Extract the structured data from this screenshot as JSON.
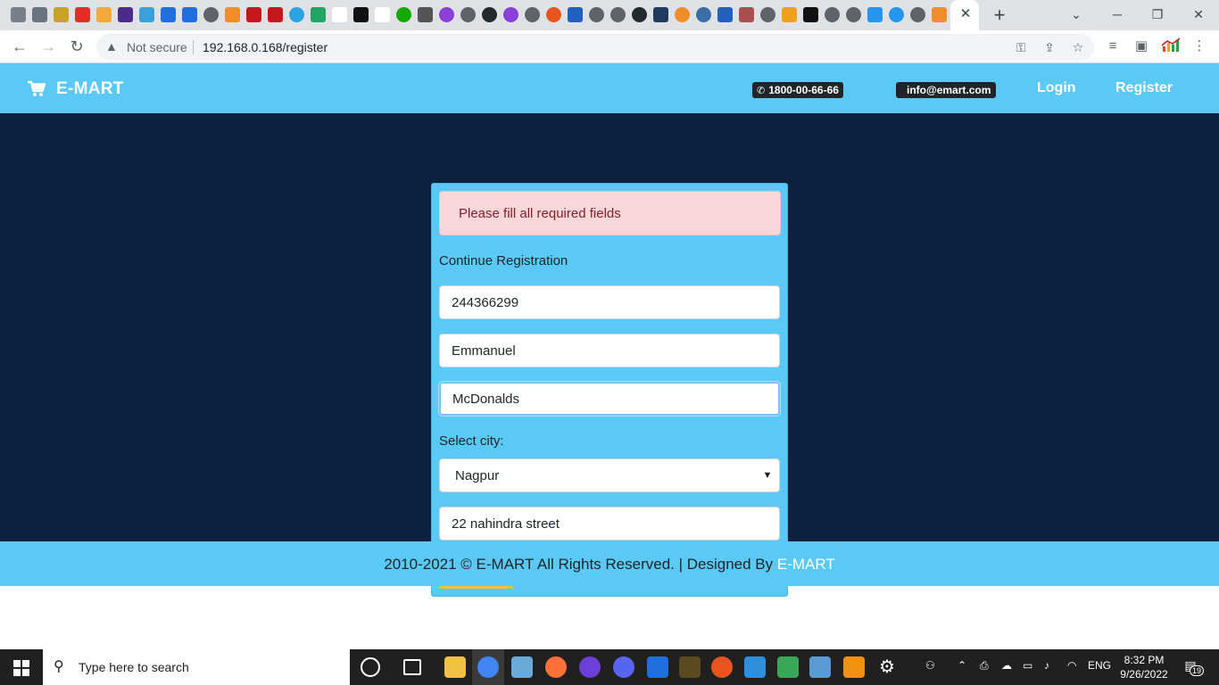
{
  "browser": {
    "address": {
      "security_label": "Not secure",
      "url": "192.168.0.168/register"
    }
  },
  "header": {
    "brand": "E-MART",
    "phone": "1800-00-66-66",
    "email": "info@emart.com",
    "nav": {
      "login": "Login",
      "register": "Register"
    }
  },
  "form": {
    "alert": "Please fill all required fields",
    "heading": "Continue Registration",
    "fields": {
      "phone": "244366299",
      "first_name": "Emmanuel",
      "last_name": "McDonalds",
      "address": "22 nahindra street"
    },
    "city_label": "Select city:",
    "city_selected": "Nagpur"
  },
  "footer": {
    "text": "2010-2021 © E-MART All Rights Reserved. | Designed By",
    "brand": "E-MART"
  },
  "taskbar": {
    "search_placeholder": "Type here to search",
    "language": "ENG",
    "time": "8:32 PM",
    "date": "9/26/2022",
    "notification_count": "19"
  },
  "colors": {
    "header_bg": "#5bc9f5",
    "main_bg": "#0b213d",
    "alert_bg": "#f8d7da",
    "alert_text": "#842029",
    "accent_yellow": "#f2c230"
  }
}
